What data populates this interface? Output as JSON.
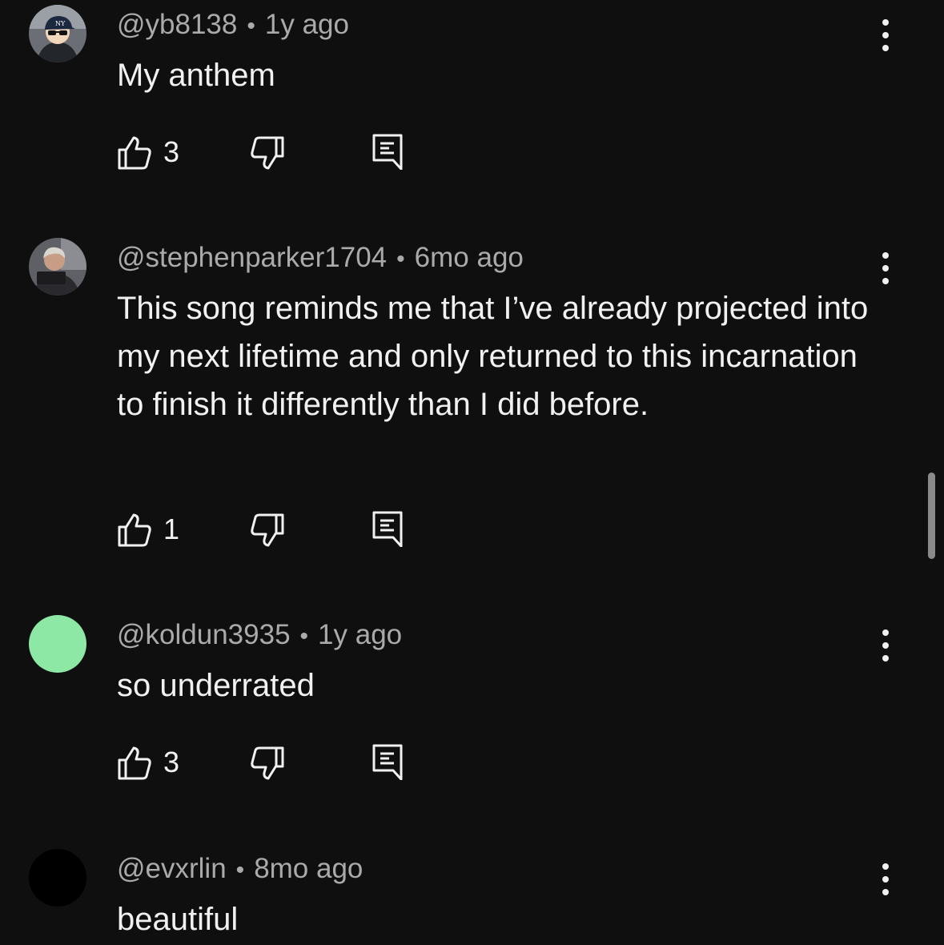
{
  "comments": [
    {
      "handle": "@yb8138",
      "time": "1y ago",
      "text": "My anthem",
      "likes": "3",
      "avatar": "photo-cap-sunglasses"
    },
    {
      "handle": "@stephenparker1704",
      "time": "6mo ago",
      "text": "This song reminds me that I’ve already projected into my next lifetime and only returned to this incarnation to finish it differently than I did before.",
      "likes": "1",
      "avatar": "photo-person"
    },
    {
      "handle": "@koldun3935",
      "time": "1y ago",
      "text": "so underrated",
      "likes": "3",
      "avatar_color": "#8ee8a5"
    },
    {
      "handle": "@evxrlin",
      "time": "8mo ago",
      "text": "beautiful",
      "avatar_color": "#000000"
    }
  ],
  "separator": "•",
  "icons": {
    "like": "thumbs-up-icon",
    "dislike": "thumbs-down-icon",
    "reply": "reply-comment-icon",
    "more": "more-vertical-icon"
  }
}
